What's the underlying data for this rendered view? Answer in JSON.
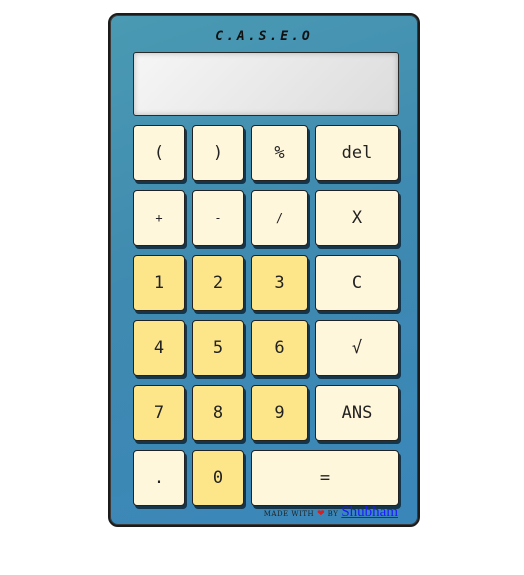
{
  "brand": "C.A.S.E.O",
  "display": {
    "value": ""
  },
  "keys": {
    "open_paren": "(",
    "close_paren": ")",
    "percent": "%",
    "del": "del",
    "plus": "+",
    "minus": "-",
    "divide": "/",
    "multiply": "X",
    "one": "1",
    "two": "2",
    "three": "3",
    "clear": "C",
    "four": "4",
    "five": "5",
    "six": "6",
    "sqrt": "√",
    "seven": "7",
    "eight": "8",
    "nine": "9",
    "ans": "ANS",
    "dot": ".",
    "zero": "0",
    "equals": "="
  },
  "footer": {
    "made_with": "MADE WITH",
    "by": "BY",
    "author": "Shubham"
  },
  "icons": {
    "heart": "heart-icon"
  },
  "colors": {
    "body": "#3f8ab0",
    "number_key": "#fde68a",
    "function_key": "#fff7dc"
  }
}
